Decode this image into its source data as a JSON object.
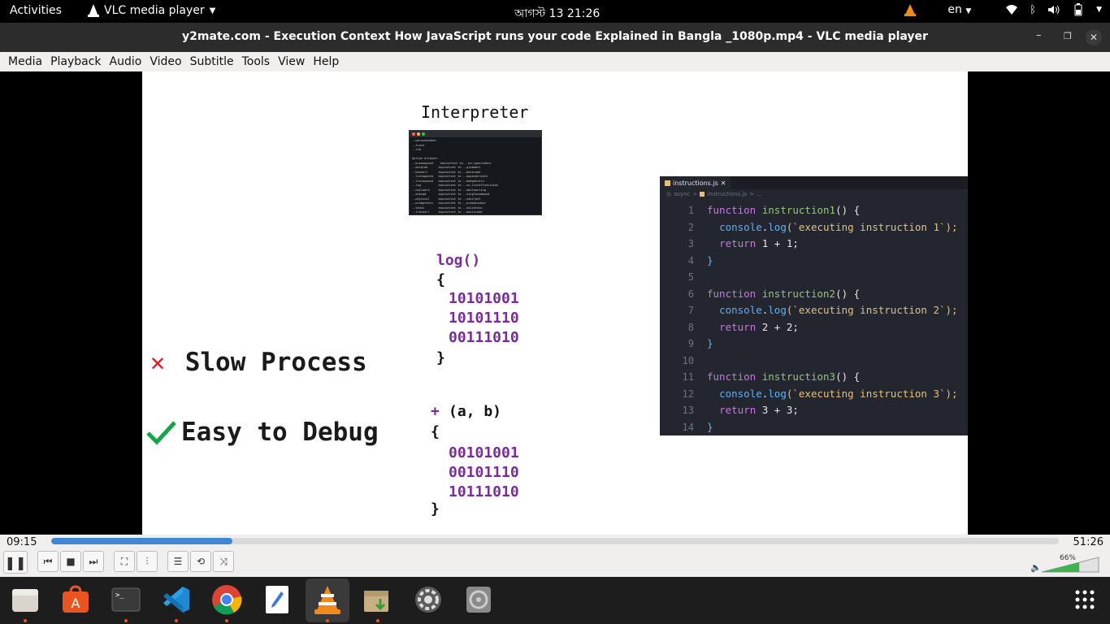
{
  "topbar": {
    "activities": "Activities",
    "app_name": "VLC media player",
    "clock": "আগস্ট 13  21:26",
    "lang": "en"
  },
  "window": {
    "title": "y2mate.com - Execution Context  How JavaScript runs your code  Explained in Bangla _1080p.mp4 - VLC media player"
  },
  "menu": [
    "Media",
    "Playback",
    "Audio",
    "Video",
    "Subtitle",
    "Tools",
    "View",
    "Help"
  ],
  "slide": {
    "interpreter_title": "Interpreter",
    "terminal_lines": [
      "--warnnodedeer",
      "--trace",
      "--lib",
      "",
      "Option aliases:",
      "--browsepand    equivalent to --no-ignoredocs",
      "--durglob      equivalent to --globdots",
      "--baskell      equivalent to --baskcode",
      "--listappend   equivalent to --appendcreate",
      "--listexpand   equivalent to --badpattern",
      "--log          equivalent to --no-listoffunctions",
      "--noilware     equivalent to --mailwarning",
      "--onecmd       equivalent to --singlecommand",
      "--physical     equivalent to --cdsilent",
      "--promptvars   equivalent to --promptsubst",
      "--stdin        equivalent to --shinstdin",
      "--trackall     equivalent to --basiccode"
    ],
    "log_block": {
      "header": "log()",
      "open": "{",
      "bits": [
        "10101001",
        "10101110",
        "00111010"
      ],
      "close": "}"
    },
    "plus_block": {
      "op": "+",
      "args": "(a, b)",
      "open": "{",
      "bits": [
        "00101001",
        "00101110",
        "10111010"
      ],
      "close": "}"
    },
    "con": "Slow Process",
    "pro": "Easy to Debug"
  },
  "editor": {
    "tab": "instructions.js",
    "crumb_a": "async",
    "crumb_b": "instructions.js",
    "crumb_c": "...",
    "line_numbers": [
      "1",
      "2",
      "3",
      "4",
      "5",
      "6",
      "7",
      "8",
      "9",
      "10",
      "11",
      "12",
      "13",
      "14"
    ],
    "code": [
      {
        "kw": "function",
        "fn": "instruction1",
        "rest": "() {"
      },
      {
        "obj": "console",
        "dot": ".",
        "meth": "log",
        "str": "(`executing instruction 1`);"
      },
      {
        "kw": "return",
        "expr": " 1 + 1;"
      },
      {
        "brace": "}"
      },
      {
        "blank": ""
      },
      {
        "kw": "function",
        "fn": "instruction2",
        "rest": "() {"
      },
      {
        "obj": "console",
        "dot": ".",
        "meth": "log",
        "str": "(`executing instruction 2`);"
      },
      {
        "kw": "return",
        "expr": " 2 + 2;"
      },
      {
        "brace": "}"
      },
      {
        "blank": ""
      },
      {
        "kw": "function",
        "fn": "instruction3",
        "rest": "() {"
      },
      {
        "obj": "console",
        "dot": ".",
        "meth": "log",
        "str": "(`executing instruction 3`);"
      },
      {
        "kw": "return",
        "expr": " 3 + 3;"
      },
      {
        "brace": "}"
      }
    ]
  },
  "controls": {
    "elapsed": "09:15",
    "total": "51:26",
    "progress": 0.18,
    "volume_label": "66%",
    "volume": 0.66
  },
  "dock": [
    "files",
    "software",
    "terminal",
    "vscode",
    "chrome",
    "text-editor",
    "vlc",
    "archive-manager",
    "settings",
    "disk-image"
  ]
}
